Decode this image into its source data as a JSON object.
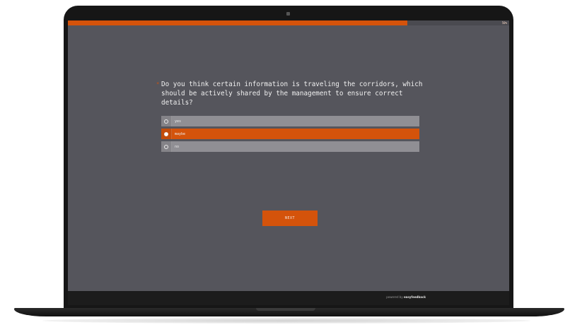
{
  "progress": {
    "label": "50%",
    "fraction": 0.77
  },
  "question": {
    "marker": "*",
    "text": "Do you think certain information is traveling the corridors, which should be actively shared by the management to ensure correct details?"
  },
  "options": [
    {
      "label": "yes",
      "selected": false
    },
    {
      "label": "maybe",
      "selected": true
    },
    {
      "label": "no",
      "selected": false
    }
  ],
  "next_label": "NEXT",
  "footer": {
    "powered_prefix": "powered by",
    "brand": "easyfeedback"
  },
  "colors": {
    "accent": "#d4530b",
    "screen_bg": "#55555c",
    "option_bg": "#908f94"
  }
}
